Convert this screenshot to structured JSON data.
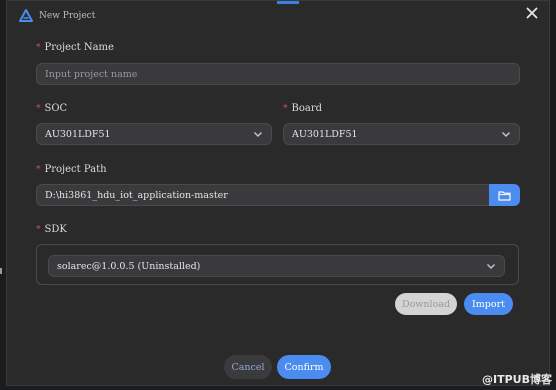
{
  "dialog": {
    "title": "New Project",
    "app_icon": "triangle-logo-icon",
    "close_icon": "close-icon"
  },
  "project_name": {
    "label": "Project Name",
    "placeholder": "Input project name",
    "required_mark": "*"
  },
  "soc": {
    "label": "SOC",
    "value": "AU301LDF51",
    "required_mark": "*"
  },
  "board": {
    "label": "Board",
    "value": "AU301LDF51",
    "required_mark": "*"
  },
  "project_path": {
    "label": "Project Path",
    "value": "D:\\hi3861_hdu_iot_application-master",
    "required_mark": "*",
    "browse_icon": "folder-icon"
  },
  "sdk": {
    "label": "SDK",
    "value": "solarec@1.0.0.5 (Uninstalled)",
    "required_mark": "*"
  },
  "actions": {
    "download": "Download",
    "import": "Import",
    "cancel": "Cancel",
    "confirm": "Confirm"
  },
  "watermark": "@ITPUB博客",
  "colors": {
    "accent": "#4a8cf0",
    "required": "#e24a4a",
    "background": "#2a2a2b"
  }
}
